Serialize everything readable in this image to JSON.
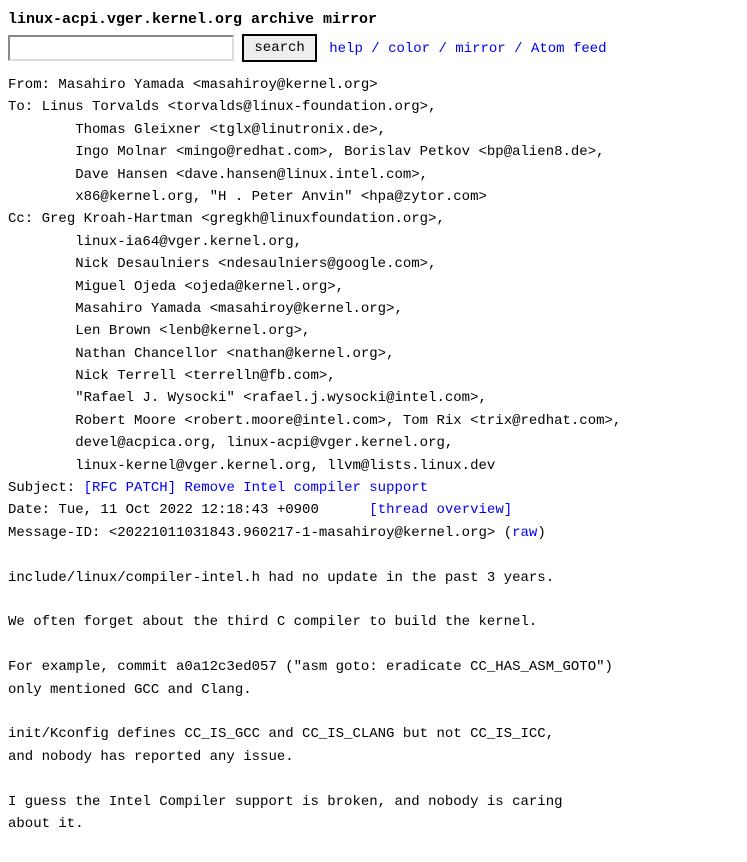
{
  "header": {
    "title": "linux-acpi.vger.kernel.org archive mirror",
    "search_button": "search",
    "nav": {
      "help": "help",
      "color": "color",
      "mirror": "mirror",
      "atom": "Atom feed"
    }
  },
  "msg": {
    "from_label": "From: ",
    "to_label": "To: ",
    "cc_label": "Cc: ",
    "subject_label": "Subject: ",
    "date_label": "Date: ",
    "msgid_label": "Message-ID: ",
    "from": "Masahiro Yamada <masahiroy@kernel.org>",
    "to_line1": "Linus Torvalds <torvalds@linux-foundation.org>,",
    "to_line2": "Thomas Gleixner <tglx@linutronix.de>,",
    "to_line3": "Ingo Molnar <mingo@redhat.com>, Borislav Petkov <bp@alien8.de>,",
    "to_line4": "Dave Hansen <dave.hansen@linux.intel.com>,",
    "to_line5": "x86@kernel.org, \"H . Peter Anvin\" <hpa@zytor.com>",
    "cc_line1": "Greg Kroah-Hartman <gregkh@linuxfoundation.org>,",
    "cc_line2": "linux-ia64@vger.kernel.org,",
    "cc_line3": "Nick Desaulniers <ndesaulniers@google.com>,",
    "cc_line4": "Miguel Ojeda <ojeda@kernel.org>,",
    "cc_line5": "Masahiro Yamada <masahiroy@kernel.org>,",
    "cc_line6": "Len Brown <lenb@kernel.org>,",
    "cc_line7": "Nathan Chancellor <nathan@kernel.org>,",
    "cc_line8": "Nick Terrell <terrelln@fb.com>,",
    "cc_line9": "\"Rafael J. Wysocki\" <rafael.j.wysocki@intel.com>,",
    "cc_line10": "Robert Moore <robert.moore@intel.com>, Tom Rix <trix@redhat.com>,",
    "cc_line11": "devel@acpica.org, linux-acpi@vger.kernel.org,",
    "cc_line12": "linux-kernel@vger.kernel.org, llvm@lists.linux.dev",
    "subject_link": "[RFC PATCH] Remove Intel compiler support",
    "date": "Tue, 11 Oct 2022 12:18:43 +0900",
    "thread_overview": "[thread overview]",
    "msgid": "<20221011031843.960217-1-masahiroy@kernel.org>",
    "raw": "raw",
    "body_p1": "include/linux/compiler-intel.h had no update in the past 3 years.",
    "body_p2": "We often forget about the third C compiler to build the kernel.",
    "body_p3a": "For example, commit a0a12c3ed057 (\"asm goto: eradicate CC_HAS_ASM_GOTO\")",
    "body_p3b": "only mentioned GCC and Clang.",
    "body_p4a": "init/Kconfig defines CC_IS_GCC and CC_IS_CLANG but not CC_IS_ICC,",
    "body_p4b": "and nobody has reported any issue.",
    "body_p5a": "I guess the Intel Compiler support is broken, and nobody is caring",
    "body_p5b": "about it."
  }
}
